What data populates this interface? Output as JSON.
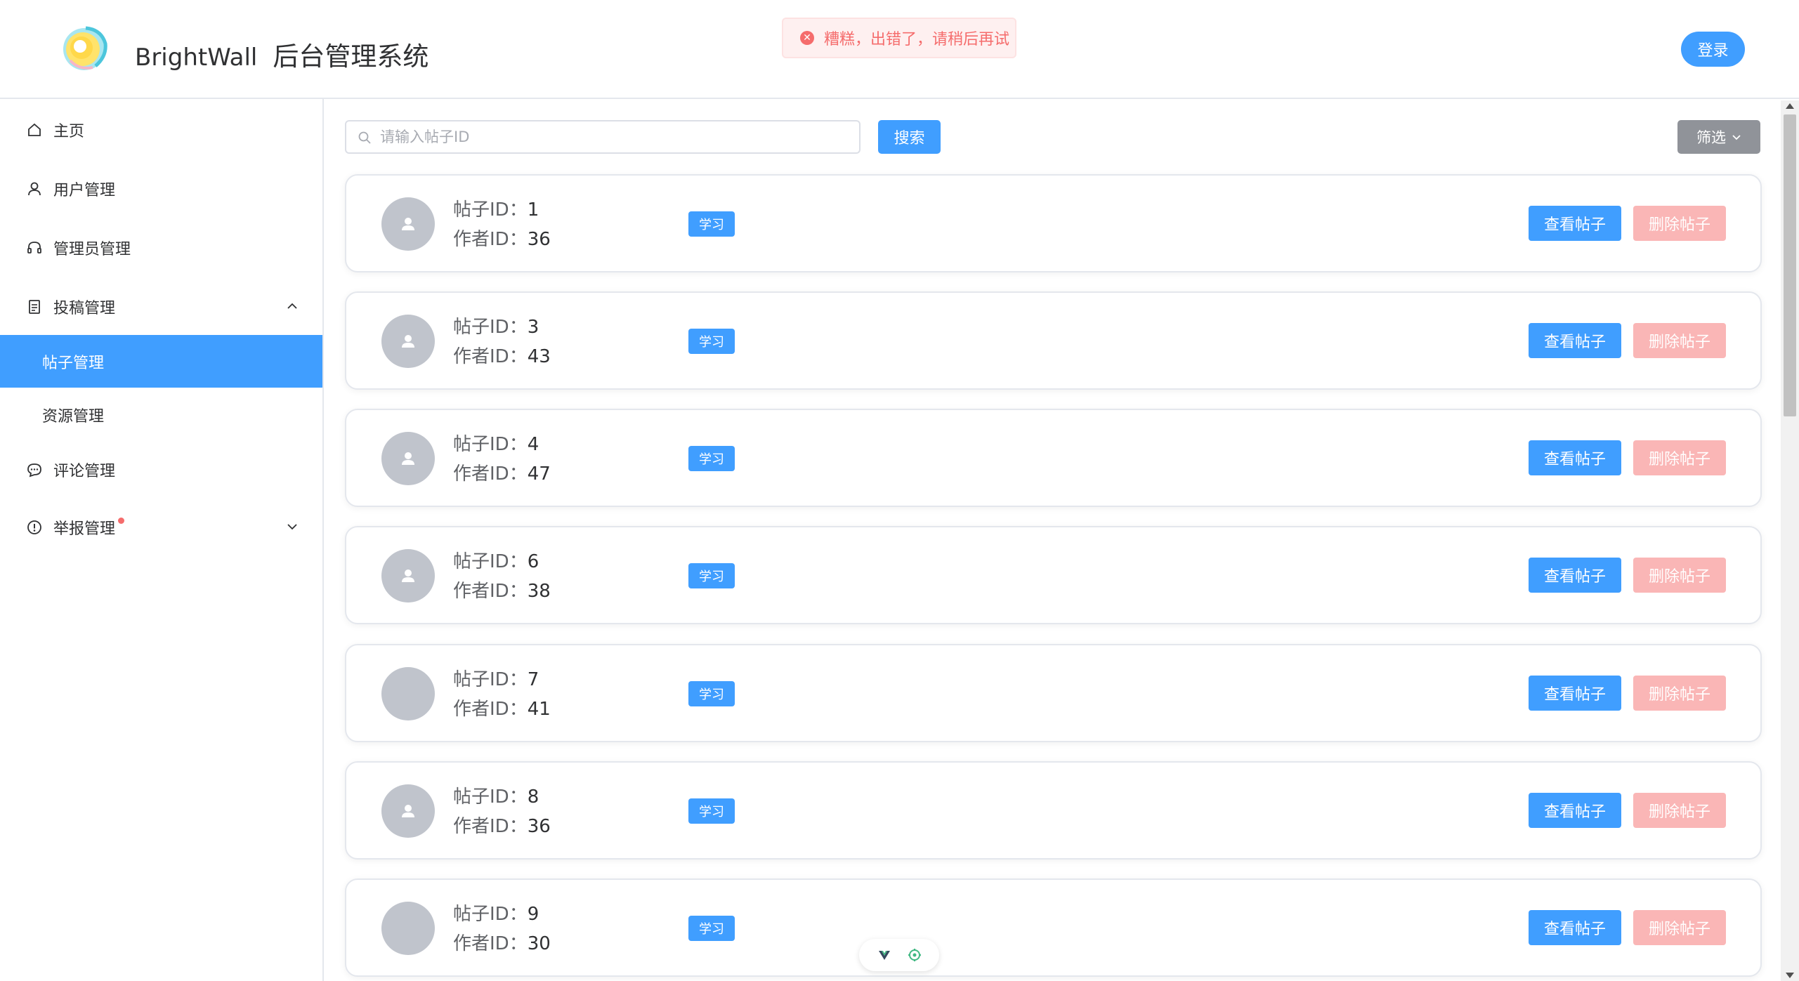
{
  "header": {
    "brand_name": "BrightWall",
    "system_name": "后台管理系统",
    "login_label": "登录"
  },
  "toast": {
    "message": "糟糕，出错了，请稍后再试"
  },
  "sidebar": {
    "items": [
      {
        "label": "主页",
        "icon": "home-icon"
      },
      {
        "label": "用户管理",
        "icon": "user-icon"
      },
      {
        "label": "管理员管理",
        "icon": "headset-icon"
      },
      {
        "label": "投稿管理",
        "icon": "document-icon",
        "expanded": true
      },
      {
        "label": "帖子管理",
        "active": true
      },
      {
        "label": "资源管理"
      },
      {
        "label": "评论管理",
        "icon": "chat-icon"
      },
      {
        "label": "举报管理",
        "icon": "warning-icon",
        "has_badge": true
      }
    ]
  },
  "search": {
    "placeholder": "请输入帖子ID",
    "button_label": "搜索"
  },
  "filter": {
    "label": "筛选"
  },
  "posts": [
    {
      "post_label": "帖子ID：",
      "post_id": "1",
      "author_label": "作者ID：",
      "author_id": "36",
      "tag": "学习",
      "view": "查看帖子",
      "delete": "删除帖子"
    },
    {
      "post_label": "帖子ID：",
      "post_id": "3",
      "author_label": "作者ID：",
      "author_id": "43",
      "tag": "学习",
      "view": "查看帖子",
      "delete": "删除帖子"
    },
    {
      "post_label": "帖子ID：",
      "post_id": "4",
      "author_label": "作者ID：",
      "author_id": "47",
      "tag": "学习",
      "view": "查看帖子",
      "delete": "删除帖子"
    },
    {
      "post_label": "帖子ID：",
      "post_id": "6",
      "author_label": "作者ID：",
      "author_id": "38",
      "tag": "学习",
      "view": "查看帖子",
      "delete": "删除帖子"
    },
    {
      "post_label": "帖子ID：",
      "post_id": "7",
      "author_label": "作者ID：",
      "author_id": "41",
      "tag": "学习",
      "view": "查看帖子",
      "delete": "删除帖子"
    },
    {
      "post_label": "帖子ID：",
      "post_id": "8",
      "author_label": "作者ID：",
      "author_id": "36",
      "tag": "学习",
      "view": "查看帖子",
      "delete": "删除帖子"
    },
    {
      "post_label": "帖子ID：",
      "post_id": "9",
      "author_label": "作者ID：",
      "author_id": "30",
      "tag": "学习",
      "view": "查看帖子",
      "delete": "删除帖子"
    }
  ],
  "colors": {
    "primary": "#409eff",
    "danger_light": "#fab6b6",
    "error": "#f56c6c",
    "neutral": "#909399"
  }
}
